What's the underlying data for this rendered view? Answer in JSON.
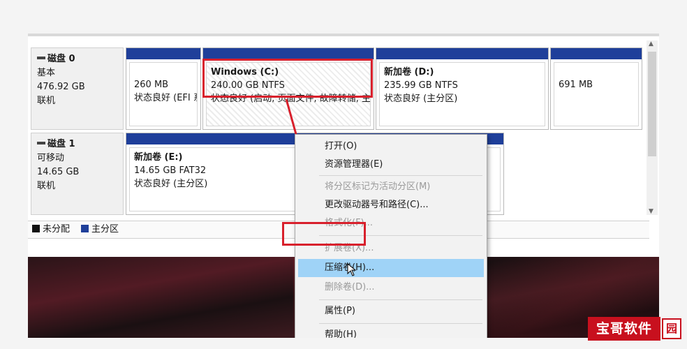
{
  "disks": [
    {
      "name": "磁盘 0",
      "type": "基本",
      "size": "476.92 GB",
      "status": "联机",
      "volumes": [
        {
          "title": "",
          "line1": "260 MB",
          "line2": "状态良好 (EFI 系统分区)"
        },
        {
          "title": "Windows  (C:)",
          "line1": "240.00 GB NTFS",
          "line2": "状态良好 (启动, 页面文件, 故障转储, 主分区)"
        },
        {
          "title": "新加卷  (D:)",
          "line1": "235.99 GB NTFS",
          "line2": "状态良好 (主分区)"
        },
        {
          "title": "",
          "line1": "691 MB",
          "line2": ""
        }
      ]
    },
    {
      "name": "磁盘 1",
      "type": "可移动",
      "size": "14.65 GB",
      "status": "联机",
      "volumes": [
        {
          "title": "新加卷  (E:)",
          "line1": "14.65 GB FAT32",
          "line2": "状态良好 (主分区)"
        }
      ]
    }
  ],
  "legend": {
    "unallocated": "未分配",
    "primary": "主分区"
  },
  "context_menu": {
    "items": [
      {
        "label": "打开(O)",
        "enabled": true
      },
      {
        "label": "资源管理器(E)",
        "enabled": true
      },
      {
        "label": "将分区标记为活动分区(M)",
        "enabled": false
      },
      {
        "label": "更改驱动器号和路径(C)...",
        "enabled": true
      },
      {
        "label": "格式化(F)...",
        "enabled": false
      },
      {
        "label": "扩展卷(X)...",
        "enabled": false
      },
      {
        "label": "压缩卷(H)...",
        "enabled": true,
        "highlighted": true
      },
      {
        "label": "删除卷(D)...",
        "enabled": false
      },
      {
        "label": "属性(P)",
        "enabled": true
      },
      {
        "label": "帮助(H)",
        "enabled": true
      }
    ]
  },
  "watermark": {
    "text": "宝哥软件",
    "badge": "园"
  },
  "colors": {
    "primary_partition": "#1f3f9a",
    "unallocated": "#111111",
    "highlight": "#9fd3f7",
    "annotation_red": "#d8202c",
    "watermark_red": "#c8101e"
  },
  "icons": {
    "disk_icon": "disk-icon",
    "cursor": "pointer-cursor-icon"
  }
}
